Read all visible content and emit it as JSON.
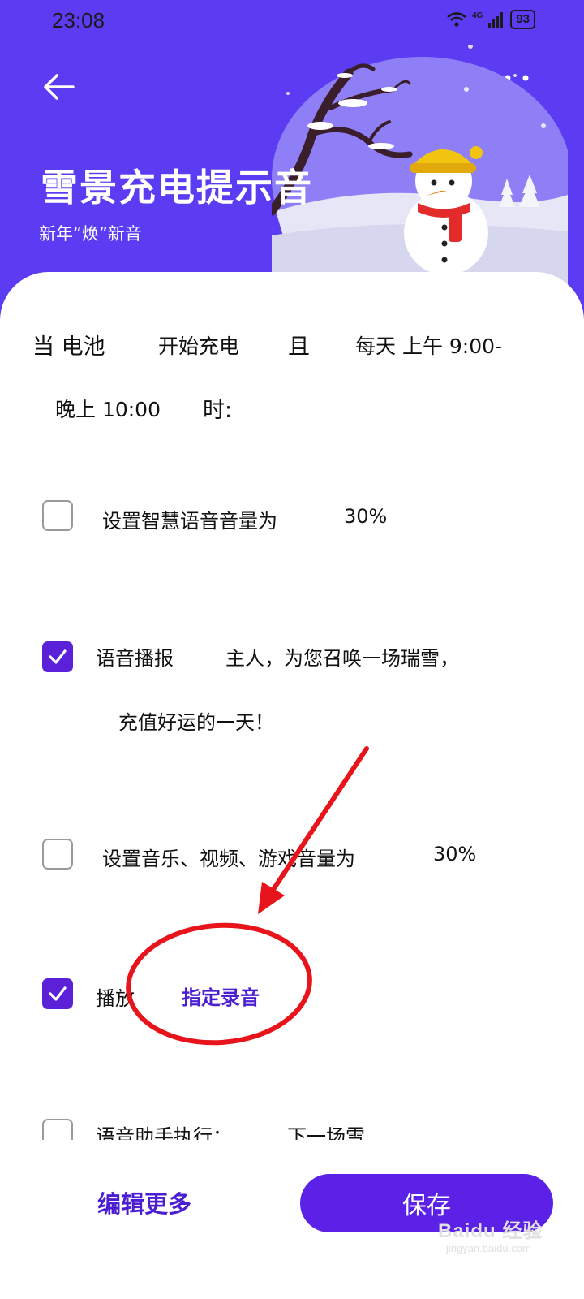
{
  "status_bar": {
    "time": "23:08",
    "network": "4G",
    "battery": "93"
  },
  "header": {
    "title": "雪景充电提示音",
    "subtitle": "新年“焕”新音"
  },
  "condition": {
    "prefix": "当 电池",
    "trigger": "开始充电",
    "and": "且",
    "time_range": "每天 上午 9:00-",
    "time_range_end": "晚上 10:00",
    "suffix": "时:"
  },
  "options": [
    {
      "checked": false,
      "label": "设置智慧语音音量为",
      "value": "30%"
    },
    {
      "checked": true,
      "label": "语音播报",
      "value": "主人，为您召唤一场瑞雪，",
      "value_line2": "充值好运的一天！"
    },
    {
      "checked": false,
      "label": "设置音乐、视频、游戏音量为",
      "value": "30%"
    },
    {
      "checked": true,
      "label": "播放",
      "value": "指定录音"
    },
    {
      "checked": false,
      "label": "语音助手执行：",
      "value": "下一场雪"
    }
  ],
  "footer": {
    "edit_more": "编辑更多",
    "save": "保存"
  },
  "watermark": {
    "logo": "Baidu 经验",
    "site": "jingyan.baidu.com"
  },
  "colors": {
    "header_bg": "#5b3cf2",
    "accent": "#5b21e6",
    "annotation": "#e8141c"
  },
  "icons": [
    "back-arrow-icon",
    "more-grid-icon",
    "wifi-icon",
    "signal-icon",
    "checkmark-icon"
  ]
}
